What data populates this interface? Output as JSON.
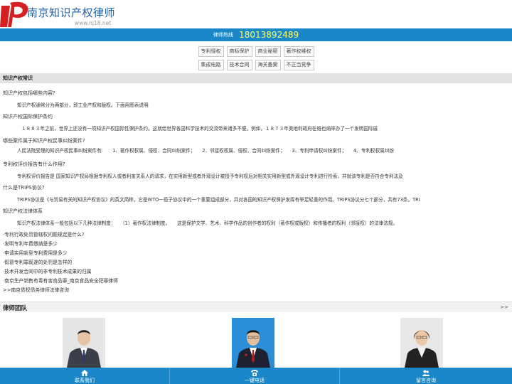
{
  "header": {
    "logo_title": "南京知识产权律师",
    "logo_url": "www.nj18.net"
  },
  "hotline": {
    "label": "律师热线",
    "number": "18013892489"
  },
  "tags_row1": [
    "专利侵权",
    "商标保护",
    "商业秘密",
    "著作权维权"
  ],
  "tags_row2": [
    "集成电路",
    "技术合同",
    "海关备案",
    "不正当竞争"
  ],
  "section_title": "知识产权常识",
  "faqs": [
    {
      "q": "知识产权包括哪些内容?",
      "a": "知识产权通常分为两部分，即工业产权和版权。下面用图表说明"
    },
    {
      "q": "知识产权国际保护条约",
      "a": "１８８３年之前，世界上还没有一项知识产权国际性保护条约。这就给世界各国科学技术的交流带来诸多不便。例如，１８７３年奥地利政府在维也纳举办了一个发明国际展"
    },
    {
      "q": "哪些案件属于知识产权民事纠纷案件?",
      "a": "人民法院受理的知识产权民事纠纷案件有:　　1、著作权权属、侵权、合同纠纷案件；　　2、邻接权权属、侵权、合同纠纷案件；　　3、专利申请权纠纷案件；　　4、专利权权属纠纷"
    },
    {
      "q": "专利权评价报告有什么作用?",
      "a": "专利权评价报告是 国家知识产权局根据专利权人或者利害关系人的请求，在实用新型或者外观设计被授予专利权后对相关实用新型或外观设计专利进行检索，并就该专利是否符合专利法及"
    },
    {
      "q": "什么是TRIPS协议?",
      "a": "TRIPS协议是《与贸易有关的知识产权协议》的英文简称，它是WTO一揽子协议中的一个重要组成部分，并对各国的知识产权保护发挥有举足轻重的作用。TRIPS协议分七个部分，共有73条。TRI"
    },
    {
      "q": "知识产权法律体系",
      "a": "知识产权法律体系一般包括以下几种法律制度：　　（1）著作权法律制度。　　这是保护文学、艺术、科学作品的创作者的权利（著作权或版权）和传播者的权利（邻接权）的法律法规。"
    }
  ],
  "links": [
    "·专利行政处罚管辖权问题规定是什么?",
    "·发明专利年费缴纳是多少",
    "·申请实用新型专利费用是多少",
    "·假冒专利罪既遂的处罚是怎样的",
    "·技术开发合同中的非专利技术成果的归属",
    "·南京生产销售有毒有害食品罪_南京食品安全犯罪律师",
    ">>南京债权债务律师法律咨询"
  ],
  "team": {
    "title": "律师团队",
    "more": ">>"
  },
  "bottom_nav": [
    {
      "label": "联系我们",
      "icon": "home-icon"
    },
    {
      "label": "一键电话",
      "icon": "phone-icon"
    },
    {
      "label": "留言咨询",
      "icon": "users-icon"
    }
  ],
  "colors": {
    "brand_blue": "#1a88c8",
    "hotline_number": "#ffff66",
    "logo_red": "#d42020"
  }
}
